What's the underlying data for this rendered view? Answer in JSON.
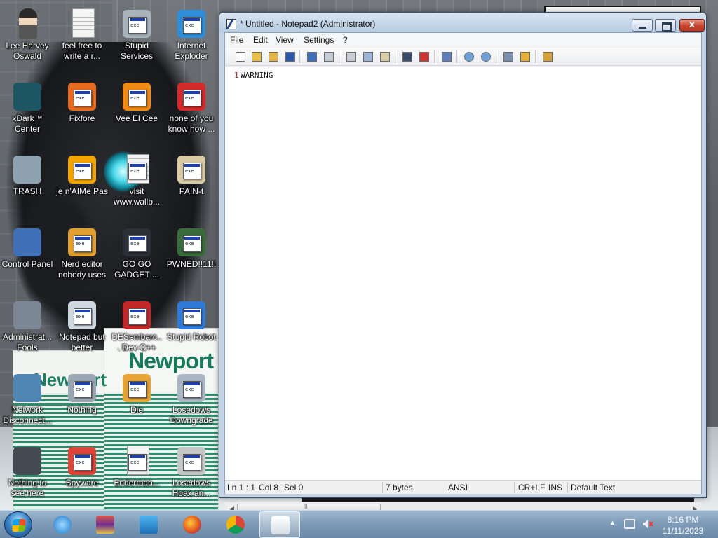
{
  "window": {
    "title": "* Untitled - Notepad2 (Administrator)",
    "close_glyph": "x"
  },
  "menu": [
    "File",
    "Edit",
    "View",
    "Settings",
    "?"
  ],
  "toolbar_icons": [
    "new-file-icon",
    "open-file-icon",
    "browse-icon",
    "save-icon",
    "undo-icon",
    "redo-icon",
    "cut-icon",
    "copy-icon",
    "paste-icon",
    "find-icon",
    "replace-icon",
    "word-wrap-icon",
    "zoom-in-icon",
    "zoom-out-icon",
    "scheme-icon",
    "customize-scheme-icon",
    "exit-icon"
  ],
  "editor": {
    "line_number": "1",
    "text": "WARNING"
  },
  "statusbar": {
    "position": "Ln 1 : 1",
    "column": "Col 8",
    "selection": "Sel 0",
    "size": "7 bytes",
    "encoding": "ANSI",
    "line_ending": "CR+LF",
    "insert_mode": "INS",
    "scheme": "Default Text"
  },
  "scrollbar": {
    "thumb_grip": "III"
  },
  "desktop_icons": [
    {
      "label": "Lee Harvey Oswald",
      "icon": "person-icon"
    },
    {
      "label": "feel free to write a r...",
      "icon": "text-document-icon"
    },
    {
      "label": "Stupid Services",
      "icon": "services-gear-icon"
    },
    {
      "label": "Internet Exploder",
      "icon": "internet-explorer-icon"
    },
    {
      "label": "xDark™ Center",
      "icon": "camera-eye-icon"
    },
    {
      "label": "Fixfore",
      "icon": "firefox-icon"
    },
    {
      "label": "Vee El Cee",
      "icon": "vlc-cone-icon"
    },
    {
      "label": "none of you know how ...",
      "icon": "opera-icon"
    },
    {
      "label": "TRASH",
      "icon": "recycle-bin-icon"
    },
    {
      "label": "je n'AIMe Pas",
      "icon": "aimp-icon"
    },
    {
      "label": "visit www.wallb...",
      "icon": "text-document-icon"
    },
    {
      "label": "PAIN-t",
      "icon": "paint-palette-icon"
    },
    {
      "label": "Control Panel",
      "icon": "control-panel-icon"
    },
    {
      "label": "Nerd editor nobody uses",
      "icon": "code-editor-icon"
    },
    {
      "label": "GO GO GADGET ...",
      "icon": "gadget-tower-icon"
    },
    {
      "label": "PWNED!!11!!",
      "icon": "terminal-icon"
    },
    {
      "label": "Administrat... Fools",
      "icon": "admin-tools-icon"
    },
    {
      "label": "Notepad but better",
      "icon": "notepad-icon"
    },
    {
      "label": "DESembarc... Dev-C++",
      "icon": "dev-cpp-icon"
    },
    {
      "label": "Stupid Robot",
      "icon": "windows-flag-icon"
    },
    {
      "label": "Network Disconnect...",
      "icon": "network-icon"
    },
    {
      "label": "Nothing",
      "icon": "empty-program-icon"
    },
    {
      "label": "Die",
      "icon": "dev-editor-icon"
    },
    {
      "label": "Losedows Downgrade",
      "icon": "globe-disc-icon"
    },
    {
      "label": "Nothing to see here",
      "icon": "phone-icon"
    },
    {
      "label": "Spyware",
      "icon": "chrome-icon"
    },
    {
      "label": "Enderman...",
      "icon": "text-document-icon"
    },
    {
      "label": "Losedows Hoax an...",
      "icon": "installer-icon"
    }
  ],
  "wallpaper_text": {
    "brand": "Newport"
  },
  "taskbar": {
    "apps": [
      "internet-explorer-icon",
      "app-archive-icon",
      "music-note-icon",
      "firefox-icon",
      "chrome-icon",
      "notepad2-icon"
    ],
    "time": "8:16 PM",
    "date": "11/11/2023"
  }
}
